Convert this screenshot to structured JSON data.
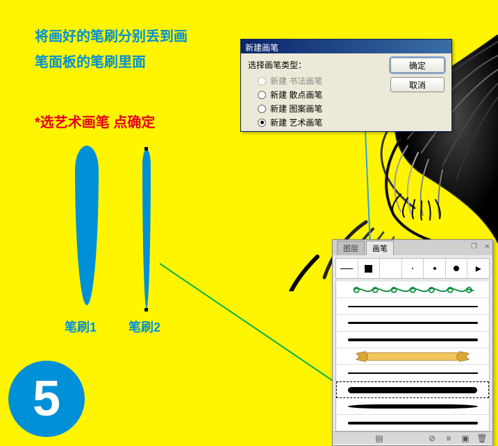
{
  "instruction": {
    "line1": "将画好的笔刷分别丢到画",
    "line2": "笔面板的笔刷里面",
    "note": "*选艺术画笔  点确定"
  },
  "brush_labels": {
    "b1": "笔刷1",
    "b2": "笔刷2"
  },
  "step_number": "5",
  "dialog": {
    "title": "新建画笔",
    "prompt": "选择画笔类型：",
    "options": {
      "calligraphy": "新建 书法画笔",
      "scatter": "新建 散点画笔",
      "pattern": "新建 图案画笔",
      "art": "新建 艺术画笔"
    },
    "ok": "确定",
    "cancel": "取消"
  },
  "brushes_panel": {
    "tab_layers": "图层",
    "tab_brushes": "画笔",
    "preset_arrow": "▸",
    "close": "×",
    "restore": "❐",
    "foot": {
      "lib": "▤",
      "disable": "⊘",
      "opts": "≡",
      "new": "▣",
      "trash": "🗑"
    }
  },
  "colors": {
    "bg": "#fff500",
    "blue": "#0090d8",
    "green_line": "#00b050",
    "blue_line": "#2ea2e6"
  }
}
